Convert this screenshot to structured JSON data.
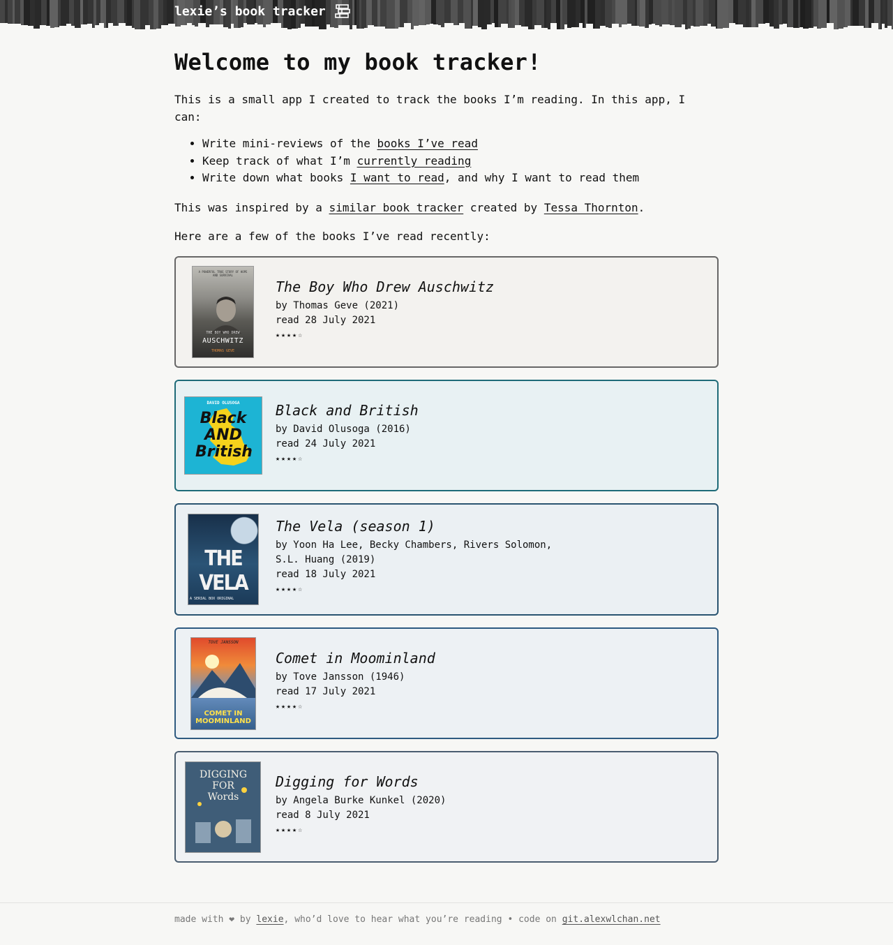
{
  "header": {
    "title": "lexie’s book tracker",
    "icon": "bookshelf-icon",
    "background": "#2b2b2b"
  },
  "main": {
    "heading": "Welcome to my book tracker!",
    "intro": "This is a small app I created to track the books I’m reading. In this app, I can:",
    "features": [
      {
        "before": "Write mini-reviews of the ",
        "link": "books I’ve read",
        "after": ""
      },
      {
        "before": "Keep track of what I’m ",
        "link": "currently reading",
        "after": ""
      },
      {
        "before": "Write down what books ",
        "link": "I want to read",
        "after": ", and why I want to read them"
      }
    ],
    "inspired": {
      "before": "This was inspired by a ",
      "link1": "similar book tracker",
      "middle": " created by ",
      "link2": "Tessa Thornton",
      "after": "."
    },
    "recent_label": "Here are a few of the books I’ve read recently:"
  },
  "books": [
    {
      "title": "The Boy Who Drew Auschwitz",
      "byline": "by Thomas Geve (2021)",
      "byline2": "",
      "read": "read 28 July 2021",
      "stars": "★★★★☆",
      "rating": 4,
      "border": "#666666",
      "bg": "#f3f2ef",
      "cover_bg": "#4a4a48",
      "cover_text_top": "A POWERFUL TRUE STORY OF HOPE AND SURVIVAL",
      "cover_text_mid": "THE BOY WHO DREW",
      "cover_text_main": "AUSCHWITZ",
      "cover_text_bottom": "THOMAS GEVE"
    },
    {
      "title": "Black and British",
      "byline": "by David Olusoga (2016)",
      "byline2": "",
      "read": "read 24 July 2021",
      "stars": "★★★★☆",
      "rating": 4,
      "border": "#1e6b78",
      "bg": "#e8f1f3",
      "cover_bg": "#1db4d4",
      "cover_text_top": "DAVID OLUSOGA",
      "cover_text_main": "Black AND British"
    },
    {
      "title": "The Vela (season 1)",
      "byline": "by Yoon Ha Lee, Becky Chambers, Rivers Solomon,",
      "byline2": "S.L. Huang (2019)",
      "read": "read 18 July 2021",
      "stars": "★★★★☆",
      "rating": 4,
      "border": "#2a5470",
      "bg": "#ebf0f3",
      "cover_bg": "#1f3d5a",
      "cover_text_main": "THE VELA",
      "cover_text_bottom": "A SERIAL BOX ORIGINAL"
    },
    {
      "title": "Comet in Moominland",
      "byline": "by Tove Jansson (1946)",
      "byline2": "",
      "read": "read 17 July 2021",
      "stars": "★★★★☆",
      "rating": 4,
      "border": "#2e5a80",
      "bg": "#edf1f4",
      "cover_bg": "#3a6e9c",
      "cover_text_top": "TOVE JANSSON",
      "cover_text_main": "COMET IN MOOMINLAND"
    },
    {
      "title": "Digging for Words",
      "byline": "by Angela Burke Kunkel (2020)",
      "byline2": "",
      "read": "read 8 July 2021",
      "stars": "★★★★☆",
      "rating": 4,
      "border": "#4a5d70",
      "bg": "#f0f2f4",
      "cover_bg": "#3f5d78",
      "cover_text_main": "DIGGING FOR Words"
    }
  ],
  "footer": {
    "before": "made with ❤ by ",
    "link1": "lexie",
    "middle": ", who’d love to hear what you’re reading • code on ",
    "link2": "git.alexwlchan.net"
  }
}
